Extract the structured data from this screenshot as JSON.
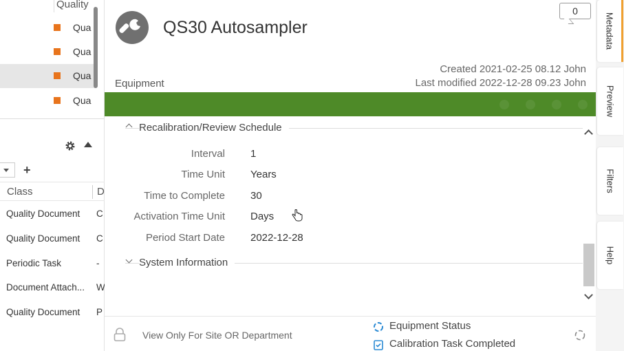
{
  "left_top": {
    "header": "Quality",
    "rows": [
      {
        "label": "Qua",
        "selected": false
      },
      {
        "label": "Qua",
        "selected": false
      },
      {
        "label": "Qua",
        "selected": true
      },
      {
        "label": "Qua",
        "selected": false
      }
    ],
    "square_color": "#e8741c"
  },
  "left_bottom": {
    "columns": [
      "Class",
      "D"
    ],
    "rows": [
      {
        "class": "Quality Document",
        "d": "C"
      },
      {
        "class": "Quality Document",
        "d": "C"
      },
      {
        "class": "Periodic Task",
        "d": "-"
      },
      {
        "class": "Document Attach...",
        "d": "W"
      },
      {
        "class": "Quality Document",
        "d": "P"
      }
    ]
  },
  "header": {
    "title": "QS30 Autosampler",
    "subtitle": "Equipment",
    "comment_count": "0",
    "created": "Created 2021-02-25 08.12 John",
    "modified": "Last modified 2022-12-28 09.23 John"
  },
  "green_bar_color": "#4e8a28",
  "sections": {
    "recal": "Recalibration/Review Schedule",
    "system": "System Information"
  },
  "fields": [
    {
      "label": "Interval",
      "value": "1"
    },
    {
      "label": "Time Unit",
      "value": "Years"
    },
    {
      "label": "Time to Complete",
      "value": "30"
    },
    {
      "label": "Activation Time Unit",
      "value": "Days"
    },
    {
      "label": "Period Start Date",
      "value": "2022-12-28"
    }
  ],
  "footer": {
    "view_only": "View Only For Site OR Department",
    "status": "Equipment Status",
    "task": "Calibration Task Completed"
  },
  "tabs": [
    "Metadata",
    "Preview",
    "Filters",
    "Help"
  ],
  "active_tab": "Metadata"
}
